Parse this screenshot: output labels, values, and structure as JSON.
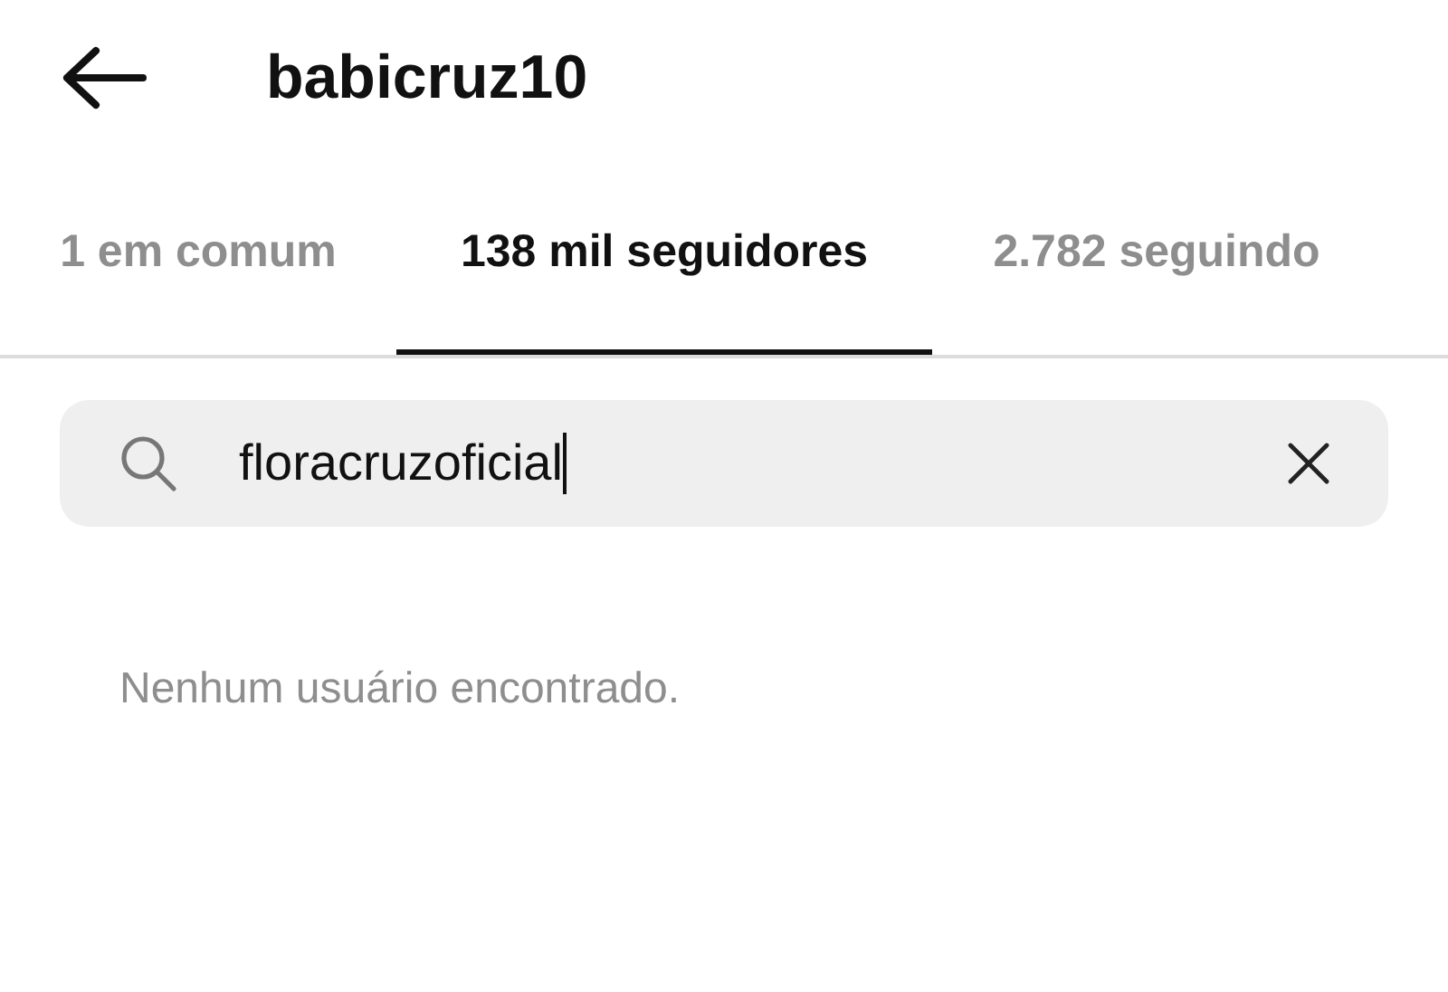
{
  "header": {
    "title": "babicruz10"
  },
  "tabs": [
    {
      "label": "1 em comum",
      "selected": false
    },
    {
      "label": "138 mil seguidores",
      "selected": true
    },
    {
      "label": "2.782 seguindo",
      "selected": false
    }
  ],
  "search": {
    "value": "floracruzoficial",
    "focused": true
  },
  "message": "Nenhum usuário encontrado."
}
